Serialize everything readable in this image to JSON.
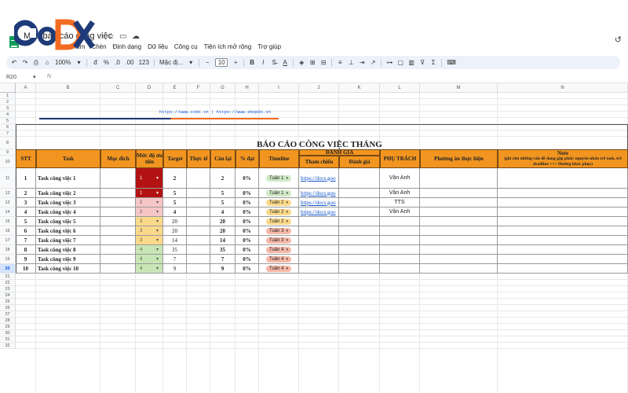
{
  "app": {
    "doc_title": "Mẫu báo cáo công việc",
    "menu": [
      "Xem",
      "Chèn",
      "Định dạng",
      "Dữ liệu",
      "Công cụ",
      "Tiện ích mở rộng",
      "Trợ giúp"
    ],
    "brand_logo_text": "CoDX"
  },
  "toolbar": {
    "zoom": "100%",
    "currency": "đ",
    "percent": "%",
    "dec_decrease": ".0",
    "dec_increase": ".00",
    "number_format": "123",
    "font": "Mặc đị...",
    "font_size": "10",
    "bold": "B",
    "italic": "I",
    "text_color": "A",
    "func": "Σ"
  },
  "formula_bar": {
    "name_box": "R20",
    "fx": "fx",
    "value": ""
  },
  "columns": [
    "A",
    "B",
    "C",
    "D",
    "E",
    "F",
    "G",
    "H",
    "I",
    "J",
    "K",
    "L",
    "M",
    "N"
  ],
  "rows": [
    "1",
    "2",
    "3",
    "4",
    "5",
    "6",
    "7",
    "8",
    "9",
    "10",
    "11",
    "12",
    "13",
    "14",
    "15",
    "16",
    "17",
    "18",
    "19",
    "20",
    "21",
    "22",
    "23",
    "24",
    "25",
    "26",
    "27",
    "28",
    "29",
    "30",
    "31",
    "32"
  ],
  "banner": {
    "links_text": "https://www.codx.vn | https://www.ebopdx.vn",
    "report_title": "BÁO CÁO CÔNG VIỆC THÁNG"
  },
  "headers": {
    "stt": "STT",
    "task": "Task",
    "muc_dich": "Mục đích",
    "muc_do_uu_tien": "Mức độ ưu tiên",
    "target": "Target",
    "thuc_te": "Thực tế",
    "con_lai": "Còn lại",
    "pct_dat": "% đạt",
    "timeline": "Timeline",
    "danh_gia_group": "ĐÁNH GIÁ",
    "tham_chieu": "Tham chiếu",
    "danh_gia": "Đánh giá",
    "phu_trach": "PHỤ TRÁCH",
    "phuong_an": "Phương án thực hiện",
    "note_title": "Note",
    "note_sub": "(ghi chú những vấn đề đang gặp phải: nguyên nhân trễ task, trễ deadline >>> Hướng khắc phục)"
  },
  "tasks": [
    {
      "stt": "1",
      "task": "Task công việc 1",
      "priority": "1",
      "target": "2",
      "remain": "2",
      "pct": "0%",
      "timeline": "Tuần 1",
      "ref": "https://docs.goo",
      "owner": "Vân Anh"
    },
    {
      "stt": "2",
      "task": "Task công việc 2",
      "priority": "1",
      "target": "5",
      "remain": "5",
      "pct": "0%",
      "timeline": "Tuần 1",
      "ref": "https://docs.goo",
      "owner": "Vân Anh"
    },
    {
      "stt": "3",
      "task": "Task công việc 3",
      "priority": "2",
      "target": "5",
      "remain": "5",
      "pct": "0%",
      "timeline": "Tuần 2",
      "ref": "https://docs.goo",
      "owner": "TTS"
    },
    {
      "stt": "4",
      "task": "Task công việc 4",
      "priority": "2",
      "target": "4",
      "remain": "4",
      "pct": "0%",
      "timeline": "Tuần 2",
      "ref": "https://docs.goo",
      "owner": "Vân Anh"
    },
    {
      "stt": "5",
      "task": "Task công việc 5",
      "priority": "3",
      "target": "20",
      "remain": "20",
      "pct": "0%",
      "timeline": "Tuần 2",
      "ref": "",
      "owner": ""
    },
    {
      "stt": "6",
      "task": "Task công việc 6",
      "priority": "3",
      "target": "20",
      "remain": "20",
      "pct": "0%",
      "timeline": "Tuần 3",
      "ref": "",
      "owner": ""
    },
    {
      "stt": "7",
      "task": "Task công việc 7",
      "priority": "3",
      "target": "14",
      "remain": "14",
      "pct": "0%",
      "timeline": "Tuần 3",
      "ref": "",
      "owner": ""
    },
    {
      "stt": "8",
      "task": "Task công việc 8",
      "priority": "4",
      "target": "35",
      "remain": "35",
      "pct": "0%",
      "timeline": "Tuần 4",
      "ref": "",
      "owner": ""
    },
    {
      "stt": "9",
      "task": "Task công việc 9",
      "priority": "4",
      "target": "7",
      "remain": "7",
      "pct": "0%",
      "timeline": "Tuần 4",
      "ref": "",
      "owner": ""
    },
    {
      "stt": "10",
      "task": "Task công việc 10",
      "priority": "4",
      "target": "9",
      "remain": "9",
      "pct": "0%",
      "timeline": "Tuần 4",
      "ref": "",
      "owner": ""
    }
  ],
  "colors": {
    "header_orange": "#f29520",
    "priority_1": "#b31212",
    "priority_2": "#f6c6c6",
    "priority_3": "#fbd98a",
    "priority_4": "#c8e6b5",
    "week_1": "#cfe8c6",
    "week_2": "#fbd98a",
    "week_3": "#f6b8a8",
    "week_4": "#f6b8a8",
    "logo_blue": "#1e3a78",
    "logo_orange": "#f26b22"
  }
}
